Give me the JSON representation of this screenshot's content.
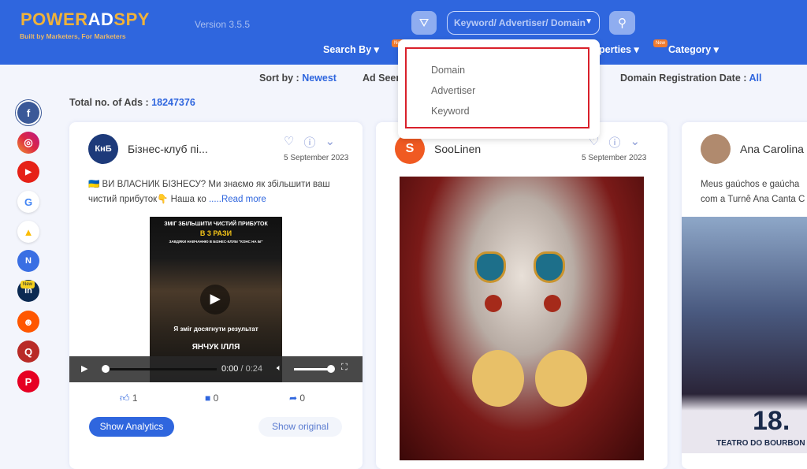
{
  "header": {
    "logo_part1": "POWER",
    "logo_part2": "AD",
    "logo_part3": "SPY",
    "tagline": "Built by Marketers, For Marketers",
    "version": "Version 3.5.5",
    "search_placeholder": "Keyword/ Advertiser/ Domain",
    "nav": [
      {
        "label": "Search By"
      },
      {
        "label": "perties",
        "badge": "New"
      },
      {
        "label": "Category",
        "badge": "New"
      }
    ]
  },
  "search_by_dropdown": {
    "options": [
      "Domain",
      "Advertiser",
      "Keyword"
    ]
  },
  "filters": {
    "sort_label": "Sort by :",
    "sort_value": "Newest",
    "ad_seen_label": "Ad Seen",
    "domain_reg_label": "Domain Registration Date :",
    "domain_reg_value": "All"
  },
  "total": {
    "label": "Total no. of Ads :",
    "value": "18247376"
  },
  "social": [
    "facebook",
    "instagram",
    "youtube",
    "google",
    "google-ads",
    "native",
    "linkedin",
    "reddit",
    "quora",
    "pinterest"
  ],
  "linkedin_badge": "New",
  "cards": [
    {
      "advertiser": "Бізнес-клуб пі...",
      "avatar_text": "КнБ",
      "date": "5 September 2023",
      "text_line1": "🇺🇦 ВИ ВЛАСНИК БІЗНЕСУ? Ми знаємо як збільшити ваш",
      "text_line2": "чистий прибуток👇 Наша ко",
      "read_more": ".....Read more",
      "video": {
        "headline": "ЗМІГ ЗБІЛЬШИТИ ЧИСТИЙ ПРИБУТОК",
        "highlight": "В 3 РАЗИ",
        "subline": "ЗАВДЯКИ НАВЧАННЮ В БІЗНЕС-КЛУБІ \"КОНС НА БІ\"",
        "caption": "Я зміг досягнути результат",
        "name": "ЯНЧУК ІЛЛЯ",
        "time": "0:00",
        "duration": "/ 0:24",
        "progress": 0,
        "volume": 1
      },
      "likes": "1",
      "comments": "0",
      "shares": "0",
      "analytics": "Show Analytics",
      "original": "Show original"
    },
    {
      "advertiser": "SooLinen",
      "avatar_text": "S",
      "date": "5 September 2023"
    },
    {
      "advertiser": "Ana Carolina",
      "text_line1": "Meus gaúchos e gaúcha",
      "text_line2": "com a Turnê Ana Canta C",
      "poster_date": "18.",
      "poster_venue": "TEATRO DO BOURBON"
    }
  ],
  "colors": {
    "header": "#2f66de",
    "accent": "#2f66de",
    "highlight_border": "#d9202b"
  }
}
